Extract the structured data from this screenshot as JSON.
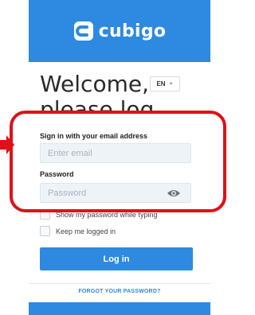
{
  "brand": {
    "name": "cubigo",
    "color": "#2d8ae0"
  },
  "welcome": {
    "heading_line1": "Welcome,",
    "heading_line2": "please log in"
  },
  "language": {
    "selected": "EN",
    "icon": "chevron-down-icon"
  },
  "form": {
    "email_label": "Sign in with your email address",
    "email_placeholder": "Enter email",
    "password_label": "Password",
    "password_placeholder": "Password",
    "password_toggle_icon": "eye-icon",
    "show_password_label": "Show my password while typing",
    "keep_logged_in_label": "Keep me logged in",
    "login_button": "Log in",
    "forgot_password": "FORGOT YOUR PASSWORD?"
  },
  "annotation": {
    "highlight_color": "#e01018"
  }
}
